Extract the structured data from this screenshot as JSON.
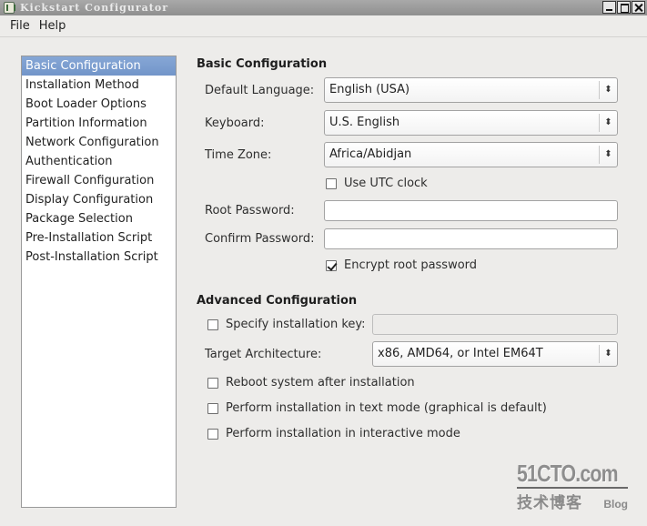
{
  "window": {
    "title": "Kickstart Configurator",
    "controls": [
      "minimize",
      "maximize",
      "close"
    ]
  },
  "menubar": {
    "items": [
      "File",
      "Help"
    ]
  },
  "sidebar": {
    "selected_index": 0,
    "items": [
      "Basic Configuration",
      "Installation Method",
      "Boot Loader Options",
      "Partition Information",
      "Network Configuration",
      "Authentication",
      "Firewall Configuration",
      "Display Configuration",
      "Package Selection",
      "Pre-Installation Script",
      "Post-Installation Script"
    ]
  },
  "basic": {
    "title": "Basic Configuration",
    "default_language_label": "Default Language:",
    "default_language_value": "English (USA)",
    "keyboard_label": "Keyboard:",
    "keyboard_value": "U.S. English",
    "time_zone_label": "Time Zone:",
    "time_zone_value": "Africa/Abidjan",
    "utc_clock_label": "Use UTC clock",
    "utc_clock_checked": false,
    "root_password_label": "Root Password:",
    "root_password_value": "",
    "confirm_password_label": "Confirm Password:",
    "confirm_password_value": "",
    "encrypt_label": "Encrypt root password",
    "encrypt_checked": true
  },
  "advanced": {
    "title": "Advanced Configuration",
    "install_key_label": "Specify installation key:",
    "install_key_checked": false,
    "install_key_value": "",
    "target_arch_label": "Target Architecture:",
    "target_arch_value": "x86, AMD64, or Intel EM64T",
    "reboot_label": "Reboot system after installation",
    "reboot_checked": false,
    "text_mode_label": "Perform installation in text mode (graphical is default)",
    "text_mode_checked": false,
    "interactive_label": "Perform installation in interactive mode",
    "interactive_checked": false
  },
  "watermark": {
    "site": "51CTO.com",
    "tagline": "技术博客",
    "blog": "Blog"
  },
  "icons": {
    "combo_arrow": "⬍"
  }
}
